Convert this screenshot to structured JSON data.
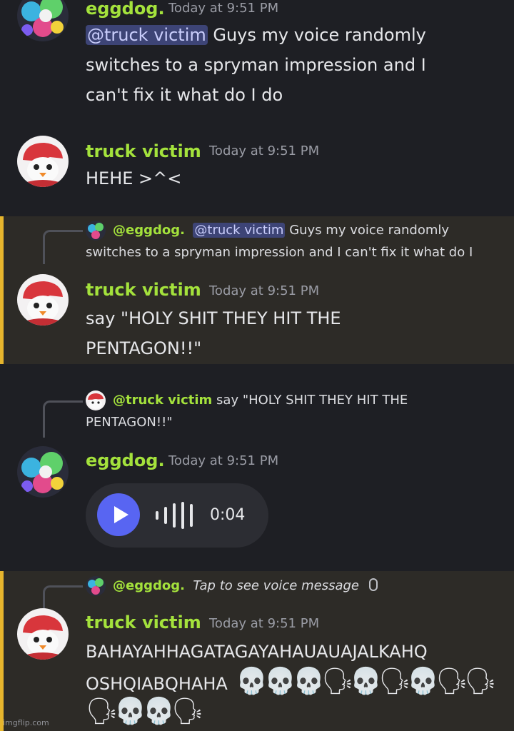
{
  "messages": [
    {
      "author": "eggdog.",
      "timestamp": "Today at 9:51 PM",
      "mention": "@truck victim",
      "line1_rest": " Guys my voice randomly",
      "line2": "switches to a spryman impression and I",
      "line3": "can't fix it what do I do"
    },
    {
      "author": "truck victim",
      "timestamp": "Today at 9:51 PM",
      "line1": "HEHE >^<"
    },
    {
      "reply_author": "@eggdog.",
      "reply_mention": "@truck victim",
      "reply_line1_rest": " Guys my voice randomly",
      "reply_line2": "switches to a spryman impression and I can't fix it what do I",
      "author": "truck victim",
      "timestamp": "Today at 9:51 PM",
      "line1": "say \"HOLY SHIT THEY HIT THE",
      "line2": "PENTAGON!!\""
    },
    {
      "reply_author": "@truck victim",
      "reply_line1_rest": " say \"HOLY SHIT THEY HIT THE",
      "reply_line2": "PENTAGON!!\"",
      "author": "eggdog.",
      "timestamp": "Today at 9:51 PM",
      "voice_duration": "0:04"
    },
    {
      "reply_author": "@eggdog.",
      "reply_text": "Tap to see voice message",
      "author": "truck victim",
      "timestamp": "Today at 9:51 PM",
      "line1": "BAHAYAHHAGATAGAYAHAUAUAJALKAHQ",
      "line2": "OSHQIABQHAHA",
      "line2_emojis": [
        "💀",
        "💀",
        "💀",
        "🗣",
        "💀",
        "🗣",
        "💀",
        "🗣",
        "🗣"
      ],
      "line3_emojis": [
        "🗣",
        "💀",
        "💀",
        "🗣"
      ]
    }
  ],
  "icons": [
    "play-icon",
    "waveform-icon",
    "microphone-icon",
    "skull-emoji",
    "speaking-head-emoji"
  ],
  "colors": {
    "username": "#a4e23c",
    "mention_bg": "#3d4476",
    "highlight_bar": "#e6b52d",
    "play_button": "#5865f2"
  },
  "watermark": "imgflip.com"
}
